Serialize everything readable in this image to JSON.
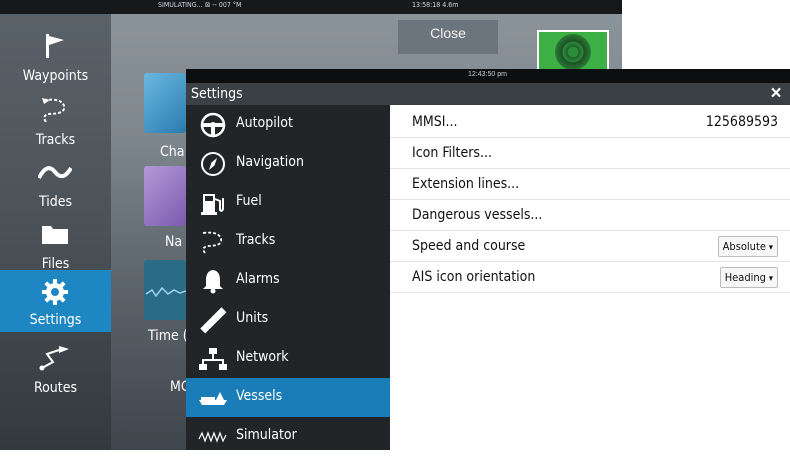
{
  "status_bar": {
    "left": "SIMULATING...",
    "mid": "⊠ -- 007 °M",
    "time": "13:58:18  4.6m"
  },
  "dock": {
    "items": [
      {
        "label": "Waypoints",
        "icon": "flag-icon"
      },
      {
        "label": "Tracks",
        "icon": "tracks-icon"
      },
      {
        "label": "Tides",
        "icon": "tides-icon"
      },
      {
        "label": "Files",
        "icon": "folder-icon"
      },
      {
        "label": "Settings",
        "icon": "gear-icon"
      },
      {
        "label": "Routes",
        "icon": "routes-icon"
      }
    ]
  },
  "background_apps": {
    "close_label": "Close",
    "label_cha": "Cha",
    "label_na": "Na",
    "label_time": "Time (",
    "label_mc": "MC"
  },
  "settings": {
    "clock": "12:43:50 pm",
    "title": "Settings",
    "close_icon": "×",
    "menu": [
      {
        "label": "Autopilot",
        "icon": "autopilot-wheel-icon"
      },
      {
        "label": "Navigation",
        "icon": "compass-icon"
      },
      {
        "label": "Fuel",
        "icon": "fuel-pump-icon"
      },
      {
        "label": "Tracks",
        "icon": "tracks-icon"
      },
      {
        "label": "Alarms",
        "icon": "bell-icon"
      },
      {
        "label": "Units",
        "icon": "ruler-icon"
      },
      {
        "label": "Network",
        "icon": "network-icon"
      },
      {
        "label": "Vessels",
        "icon": "vessels-icon",
        "active": true
      },
      {
        "label": "Simulator",
        "icon": "simulator-icon"
      }
    ],
    "rows": [
      {
        "label": "MMSI...",
        "value": "125689593"
      },
      {
        "label": "Icon Filters..."
      },
      {
        "label": "Extension lines..."
      },
      {
        "label": "Dangerous vessels..."
      },
      {
        "label": "Speed and course",
        "dropdown": "Absolute"
      },
      {
        "label": "AIS icon orientation",
        "dropdown": "Heading"
      }
    ]
  },
  "colors": {
    "accent": "#1f86c4",
    "menu_bg": "#212528",
    "titlebar_bg": "#3b4044"
  }
}
